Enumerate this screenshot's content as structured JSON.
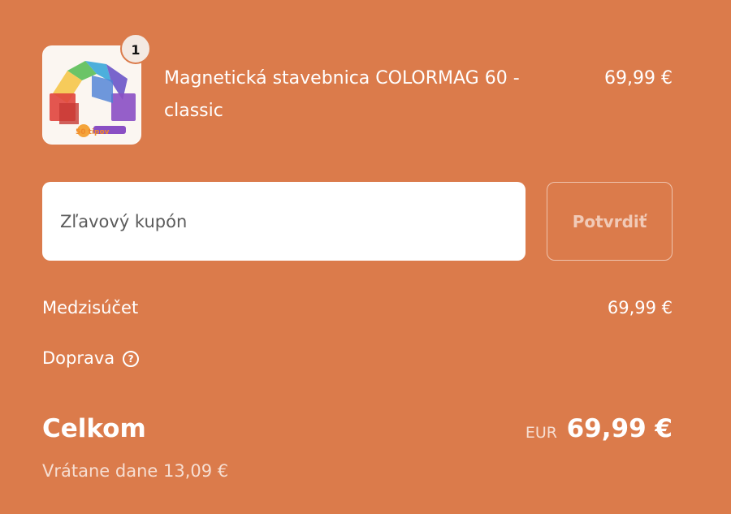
{
  "cart": {
    "item": {
      "quantity": "1",
      "name": "Magnetická stavebnica COLORMAG 60 - classic",
      "price": "69,99 €",
      "thumbnail_text": "50 tipov"
    }
  },
  "coupon": {
    "placeholder": "Zľavový kupón",
    "value": "",
    "confirm_label": "Potvrdiť"
  },
  "summary": {
    "subtotal_label": "Medzisúčet",
    "subtotal_value": "69,99 €",
    "shipping_label": "Doprava",
    "shipping_help_icon": "question-circle-icon",
    "total_label": "Celkom",
    "total_currency": "EUR",
    "total_value": "69,99 €",
    "tax_note": "Vrátane dane 13,09 €"
  },
  "colors": {
    "background": "#db7b4b",
    "text": "#ffffff",
    "input_bg": "#ffffff"
  }
}
